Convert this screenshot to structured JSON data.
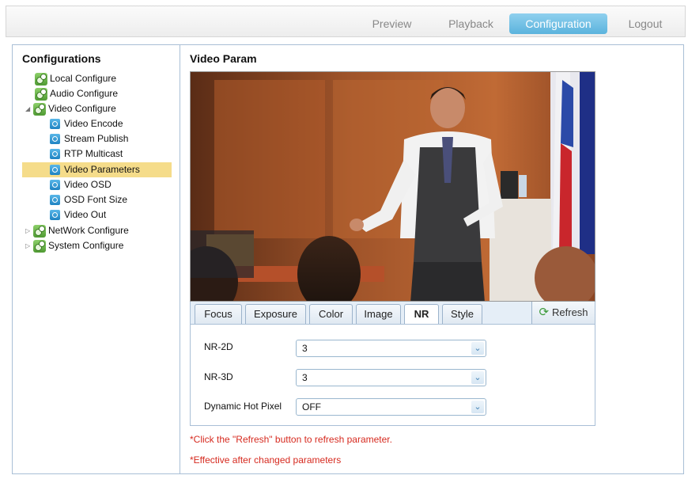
{
  "nav": {
    "preview": "Preview",
    "playback": "Playback",
    "configuration": "Configuration",
    "logout": "Logout"
  },
  "sidebar": {
    "title": "Configurations",
    "items": [
      {
        "label": "Local Configure"
      },
      {
        "label": "Audio Configure"
      },
      {
        "label": "Video Configure"
      },
      {
        "label": "Video Encode"
      },
      {
        "label": "Stream Publish"
      },
      {
        "label": "RTP Multicast"
      },
      {
        "label": "Video Parameters"
      },
      {
        "label": "Video OSD"
      },
      {
        "label": "OSD Font Size"
      },
      {
        "label": "Video Out"
      },
      {
        "label": "NetWork Configure"
      },
      {
        "label": "System Configure"
      }
    ]
  },
  "content": {
    "title": "Video Param",
    "tabs": [
      "Focus",
      "Exposure",
      "Color",
      "Image",
      "NR",
      "Style"
    ],
    "active_tab": "NR",
    "refresh_label": "Refresh",
    "fields": [
      {
        "label": "NR-2D",
        "value": "3"
      },
      {
        "label": "NR-3D",
        "value": "3"
      },
      {
        "label": "Dynamic Hot Pixel",
        "value": "OFF"
      }
    ],
    "notes": [
      "*Click the \"Refresh\" button to refresh parameter.",
      "*Effective after changed parameters"
    ]
  },
  "colors": {
    "accent": "#5bb3dd",
    "selected_bg": "#f5dc8a",
    "note_red": "#d62a1f",
    "border": "#a9bfd6"
  }
}
